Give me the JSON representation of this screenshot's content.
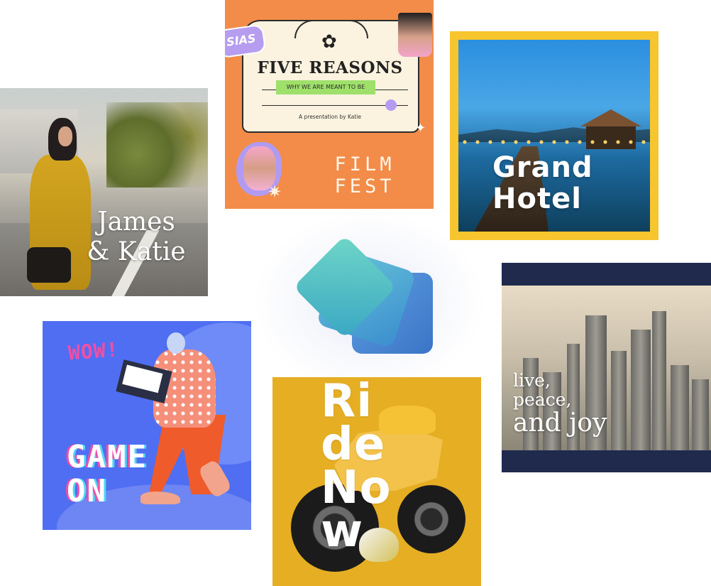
{
  "cards": {
    "wedding": {
      "title": "James\n& Katie"
    },
    "film": {
      "sticker": "SIAS",
      "headline": "FIVE REASONS",
      "tagline": "WHY WE ARE MEANT TO BE",
      "byline": "A presentation by Katie",
      "footer": "FILM FEST"
    },
    "hotel": {
      "title": "Grand\nHotel",
      "frame_color": "#f7c52e"
    },
    "game": {
      "badge": "WOW!",
      "title": "GAME\nON",
      "bg_color": "#4f6ef2"
    },
    "ride": {
      "title": "Ri\nde\nNo\nw",
      "bg_color": "#e5ae23"
    },
    "city": {
      "line1": "live,",
      "line2": "peace,",
      "line3": "and joy"
    }
  },
  "logo": {
    "icon": "stacked-cards-icon",
    "colors": [
      "#6fd6c7",
      "#3b8fcf",
      "#3b74c6"
    ]
  }
}
